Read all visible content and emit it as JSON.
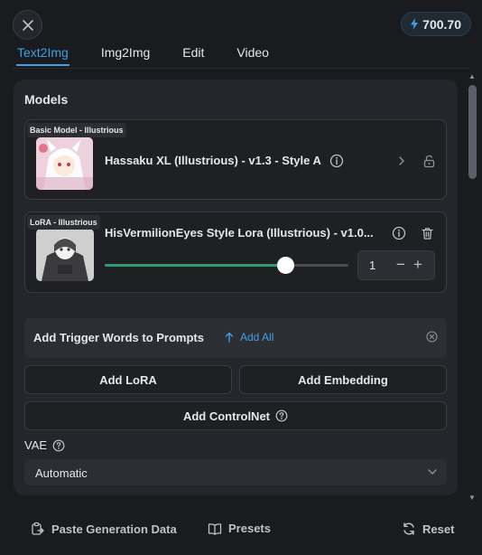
{
  "header": {
    "balance": "700.70"
  },
  "tabs": [
    {
      "label": "Text2Img",
      "active": true
    },
    {
      "label": "Img2Img",
      "active": false
    },
    {
      "label": "Edit",
      "active": false
    },
    {
      "label": "Video",
      "active": false
    }
  ],
  "models": {
    "title": "Models",
    "base": {
      "tag": "Basic Model - Illustrious",
      "name": "Hassaku XL (Illustrious) - v1.3 - Style A"
    },
    "lora": {
      "tag": "LoRA - Illustrious",
      "name": "HisVermilionEyes Style Lora (Illustrious) - v1.0...",
      "strength": 1,
      "slider_fraction": 0.74
    }
  },
  "trigger": {
    "label": "Add Trigger Words to Prompts",
    "add_all": "Add All"
  },
  "buttons": {
    "add_lora": "Add LoRA",
    "add_embedding": "Add Embedding",
    "add_controlnet": "Add ControlNet"
  },
  "vae": {
    "label": "VAE",
    "value": "Automatic"
  },
  "footer": {
    "paste": "Paste Generation Data",
    "presets": "Presets",
    "reset": "Reset"
  },
  "colors": {
    "accent": "#3fa0e4",
    "slider_fill": "#2f9e6f",
    "background": "#1a1b1e",
    "panel": "#25262b"
  }
}
